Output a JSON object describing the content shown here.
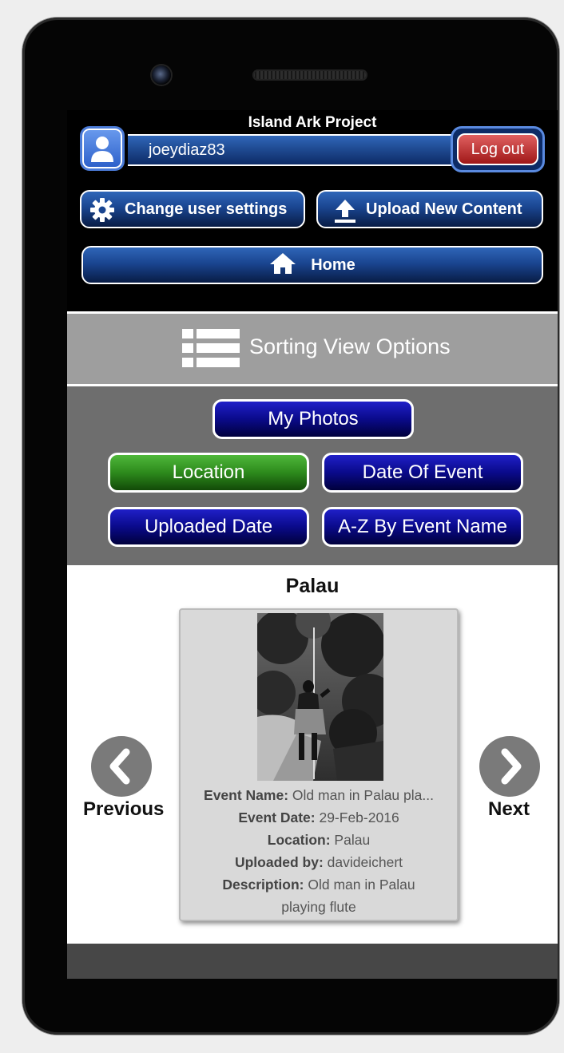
{
  "app": {
    "title": "Island Ark Project"
  },
  "user": {
    "username": "joeydiaz83",
    "logout_label": "Log out"
  },
  "toolbar": {
    "settings_label": "Change user settings",
    "upload_label": "Upload New Content",
    "home_label": "Home"
  },
  "sorting": {
    "title": "Sorting View Options",
    "options": {
      "my_photos": "My Photos",
      "location": "Location",
      "date_of_event": "Date Of Event",
      "uploaded_date": "Uploaded Date",
      "az_event_name": "A-Z By Event Name"
    },
    "active_option": "Location"
  },
  "gallery": {
    "group_title": "Palau",
    "previous_label": "Previous",
    "next_label": "Next",
    "item": {
      "event_name_label": "Event Name:",
      "event_name": "Old man in Palau pla...",
      "event_date_label": "Event Date:",
      "event_date": "29-Feb-2016",
      "location_label": "Location:",
      "location": "Palau",
      "uploaded_by_label": "Uploaded by:",
      "uploaded_by": "davideichert",
      "description_label": "Description:",
      "description_line1": "Old man in Palau",
      "description_line2": "playing flute"
    }
  },
  "icons": {
    "avatar": "user-icon",
    "settings": "gear-icon",
    "upload": "upload-icon",
    "home": "home-icon",
    "sort": "list-icon",
    "previous": "chevron-left-icon",
    "next": "chevron-right-icon"
  },
  "colors": {
    "button_blue": "#1a4590",
    "sort_button_blue": "#0a0a8a",
    "active_green": "#2d8a1c",
    "logout_red": "#a01818",
    "sort_header_gray": "#9e9e9e",
    "sort_panel_gray": "#6e6e6e"
  }
}
